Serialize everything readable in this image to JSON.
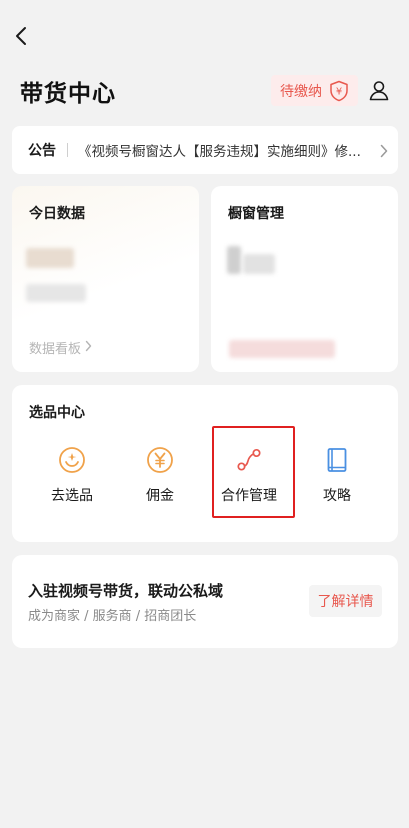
{
  "header": {
    "title": "带货中心",
    "pending_label": "待缴纳",
    "shield_symbol": "¥"
  },
  "notice": {
    "tag": "公告",
    "text": "《视频号橱窗达人【服务违规】实施细则》修..."
  },
  "today_data": {
    "title": "今日数据",
    "dashboard_link": "数据看板"
  },
  "window_manage": {
    "title": "橱窗管理"
  },
  "selection_center": {
    "title": "选品中心",
    "items": [
      {
        "label": "去选品",
        "icon": "hand-coin-icon"
      },
      {
        "label": "佣金",
        "icon": "yen-coin-icon"
      },
      {
        "label": "合作管理",
        "icon": "connection-path-icon"
      },
      {
        "label": "攻略",
        "icon": "book-icon"
      }
    ]
  },
  "promo": {
    "title": "入驻视频号带货，联动公私域",
    "subtitle": "成为商家 / 服务商 / 招商团长",
    "button": "了解详情"
  },
  "colors": {
    "accent_orange": "#f0a24a",
    "accent_red": "#e8584e",
    "book_blue": "#4a90e2",
    "highlight_red": "#e02020"
  }
}
